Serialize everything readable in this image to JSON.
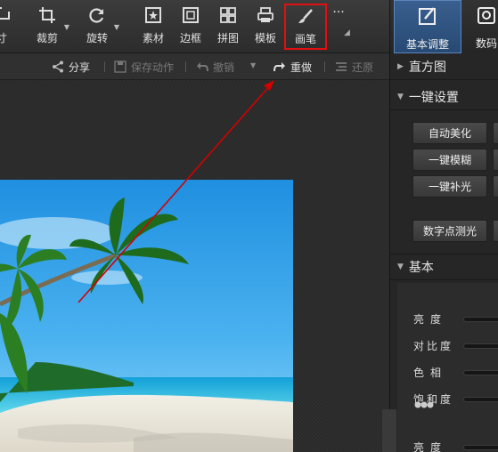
{
  "toolbar": {
    "items": [
      {
        "label": "寸",
        "icon": "resize-icon"
      },
      {
        "label": "裁剪",
        "icon": "crop-icon"
      },
      {
        "label": "旋转",
        "icon": "rotate-icon"
      },
      {
        "label": "素材",
        "icon": "star-frame-icon"
      },
      {
        "label": "边框",
        "icon": "frame-icon"
      },
      {
        "label": "拼图",
        "icon": "grid-icon"
      },
      {
        "label": "模板",
        "icon": "printer-icon"
      },
      {
        "label": "画笔",
        "icon": "brush-icon"
      },
      {
        "label": "···",
        "icon": "more-icon"
      }
    ],
    "highlighted": "画笔",
    "highlight_color": "#e01010"
  },
  "right_tabs": [
    {
      "label": "基本调整",
      "icon": "adjust-icon",
      "active": true
    },
    {
      "label": "数码",
      "icon": "camera-icon",
      "active": false
    }
  ],
  "actions": {
    "share": "分享",
    "save_action": "保存动作",
    "undo": "撤销",
    "redo": "重做",
    "restore": "还原"
  },
  "panel": {
    "histogram": "直方图",
    "one_click": "一键设置",
    "buttons": [
      "自动美化",
      "一键模糊",
      "一键补光",
      "数字点测光"
    ],
    "basic": "基本",
    "sliders": [
      "亮度",
      "对比度",
      "色相",
      "饱和度",
      "亮度"
    ]
  },
  "annotation": {
    "color": "#d40000",
    "description": "arrow pointing to 重做"
  }
}
